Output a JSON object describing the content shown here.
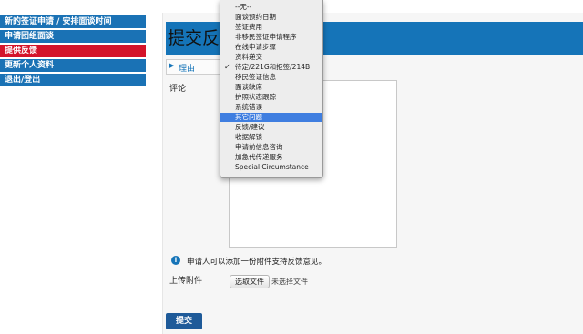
{
  "sidebar": {
    "items": [
      {
        "label": "新的签证申请 / 安排面谈时间",
        "active": false
      },
      {
        "label": "申请团组面谈",
        "active": false
      },
      {
        "label": "提供反馈",
        "active": true
      },
      {
        "label": "更新个人资料",
        "active": false
      },
      {
        "label": "退出/登出",
        "active": false
      }
    ]
  },
  "main": {
    "title": "提交反馈",
    "reason_label": "理由",
    "comment_label": "评论",
    "info_text": "申请人可以添加一份附件支持反馈意见。",
    "upload_label": "上传附件",
    "file_button": "选取文件",
    "file_status": "未选择文件",
    "submit_label": "提交"
  },
  "dropdown": {
    "options": [
      "--无--",
      "面谈预约日期",
      "签证费用",
      "非移民签证申请程序",
      "在线申请步骤",
      "资料递交",
      "待定/221G和拒签/214B",
      "移民签证信息",
      "面谈缺席",
      "护照状态跟踪",
      "系统错误",
      "其它问题",
      "反馈/建议",
      "收据解锁",
      "申请前信息咨询",
      "加急代传递服务",
      "Special Circumstance"
    ],
    "checked": "待定/221G和拒签/214B",
    "highlighted": "其它问题"
  },
  "colors": {
    "accent": "#1574b8",
    "active_nav": "#d4142a",
    "highlight": "#3f7ee0"
  }
}
